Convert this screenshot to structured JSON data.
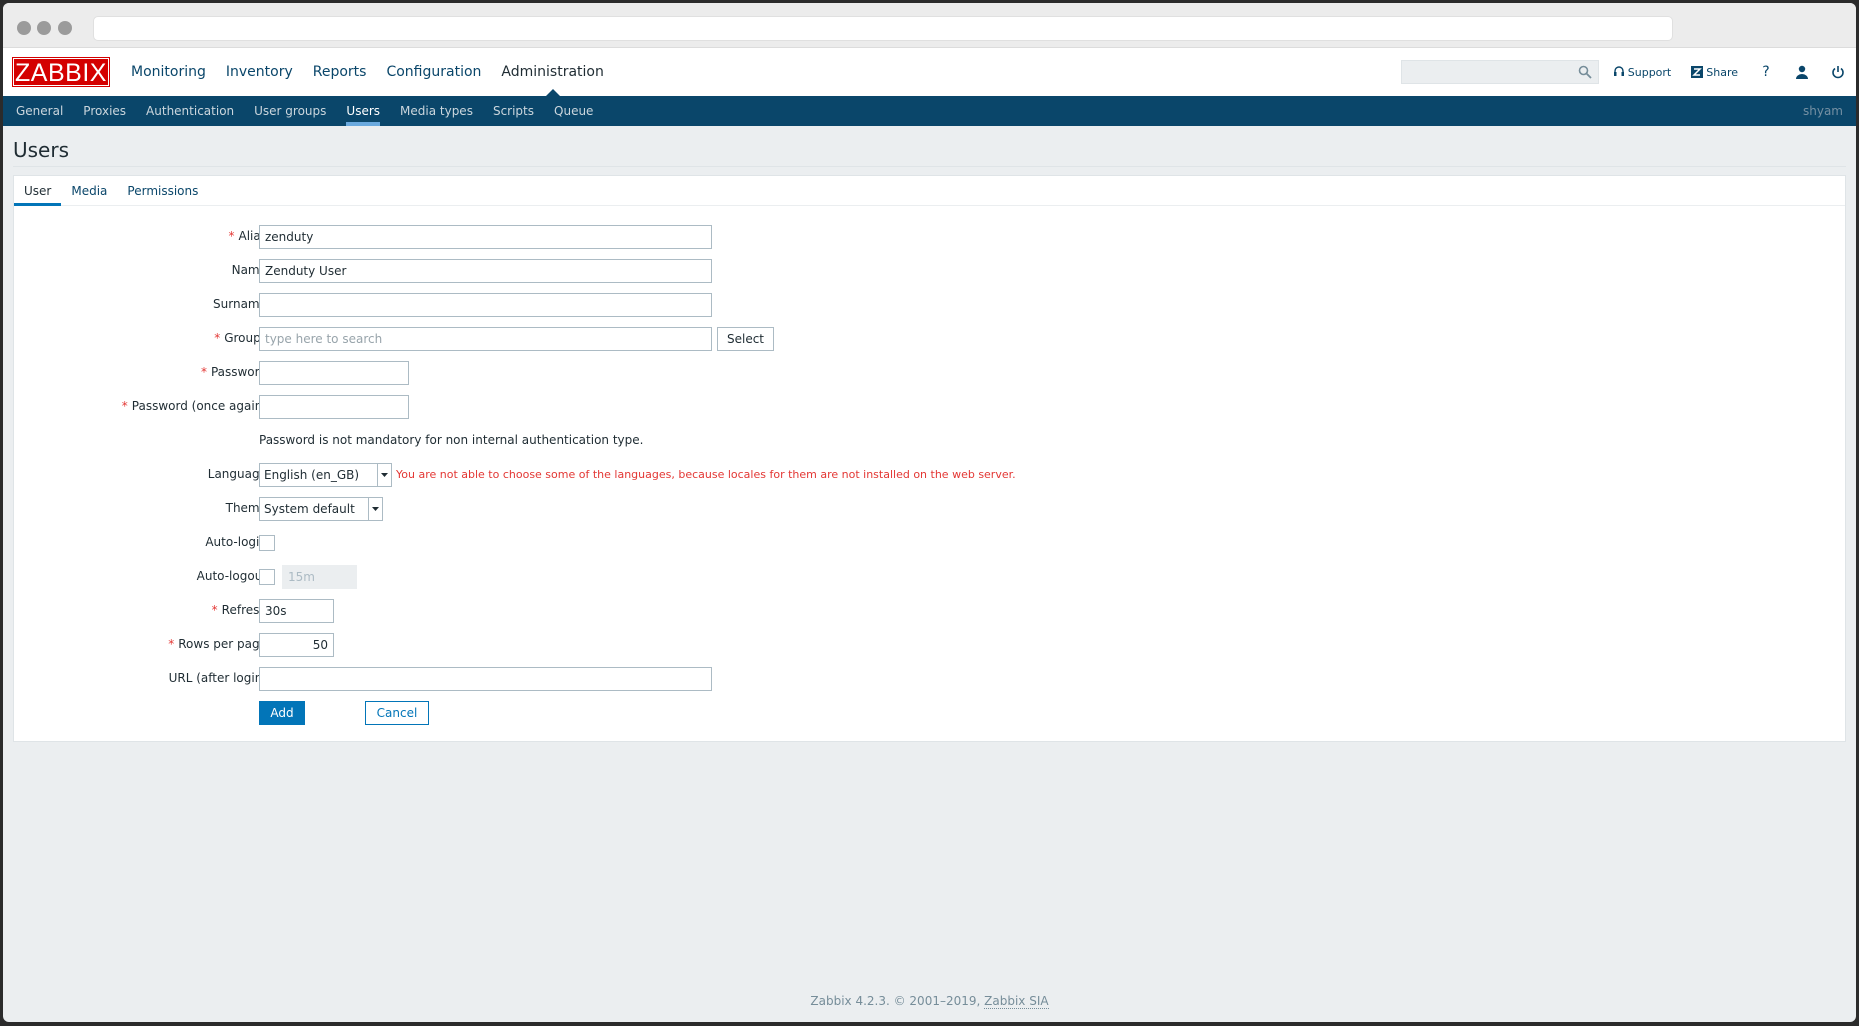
{
  "topnav": {
    "logo": "ZABBIX",
    "menu": [
      "Monitoring",
      "Inventory",
      "Reports",
      "Configuration",
      "Administration"
    ],
    "active_menu": "Administration",
    "search_placeholder": "",
    "support_label": "Support",
    "share_label": "Share",
    "help_label": "?"
  },
  "subnav": {
    "items": [
      "General",
      "Proxies",
      "Authentication",
      "User groups",
      "Users",
      "Media types",
      "Scripts",
      "Queue"
    ],
    "active": "Users",
    "username": "shyam"
  },
  "page": {
    "title": "Users"
  },
  "tabs": [
    "User",
    "Media",
    "Permissions"
  ],
  "form": {
    "alias": {
      "label": "Alias",
      "value": "zenduty"
    },
    "name": {
      "label": "Name",
      "value": "Zenduty User"
    },
    "surname": {
      "label": "Surname",
      "value": ""
    },
    "groups": {
      "label": "Groups",
      "placeholder": "type here to search",
      "button": "Select"
    },
    "password": {
      "label": "Password",
      "value": ""
    },
    "password_again": {
      "label": "Password (once again)",
      "value": ""
    },
    "password_note": "Password is not mandatory for non internal authentication type.",
    "language": {
      "label": "Language",
      "value": "English (en_GB)",
      "warning": "You are not able to choose some of the languages, because locales for them are not installed on the web server."
    },
    "theme": {
      "label": "Theme",
      "value": "System default"
    },
    "autologin": {
      "label": "Auto-login",
      "checked": false
    },
    "autologout": {
      "label": "Auto-logout",
      "checked": false,
      "value": "15m"
    },
    "refresh": {
      "label": "Refresh",
      "value": "30s"
    },
    "rows_per_page": {
      "label": "Rows per page",
      "value": "50"
    },
    "url_after_login": {
      "label": "URL (after login)",
      "value": ""
    },
    "add_button": "Add",
    "cancel_button": "Cancel"
  },
  "footer": {
    "text": "Zabbix 4.2.3. © 2001–2019,",
    "link": "Zabbix SIA"
  },
  "colors": {
    "brand_red": "#d40000",
    "nav_blue": "#0a466a",
    "primary": "#0275b8",
    "required": "#e33734"
  }
}
